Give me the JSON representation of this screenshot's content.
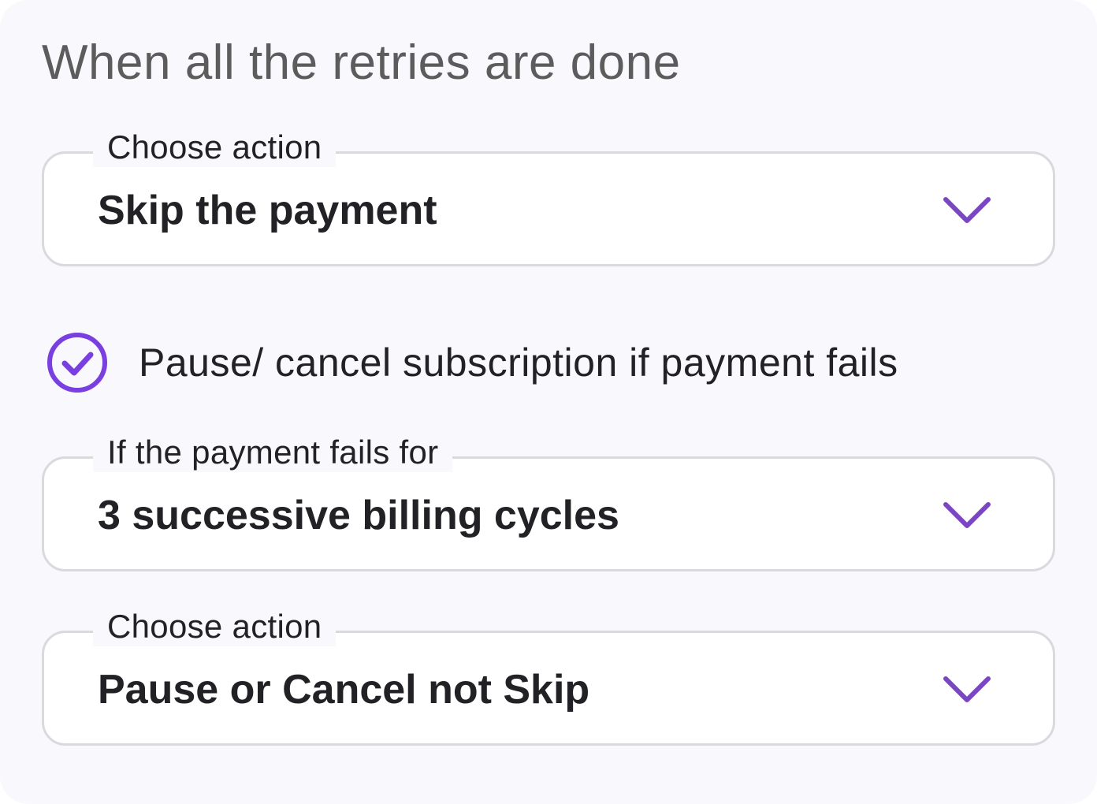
{
  "section": {
    "title": "When all the retries are done"
  },
  "fields": [
    {
      "legend": "Choose action",
      "value": "Skip the payment"
    },
    {
      "legend": "If the payment fails for",
      "value": "3 successive billing cycles"
    },
    {
      "legend": "Choose action",
      "value": "Pause or Cancel not Skip"
    }
  ],
  "pause_cancel": {
    "label": "Pause/ cancel subscription if payment fails",
    "checked": true
  },
  "icons": {
    "dropdown": "chevron-down-icon",
    "checkbox": "check-circle-icon"
  },
  "colors": {
    "accent": "#7a3fe0",
    "chevron": "#7b45c4",
    "text": "#222226",
    "title": "#5c5c5c",
    "border": "#d9d9de",
    "background": "#f8f8fd"
  }
}
